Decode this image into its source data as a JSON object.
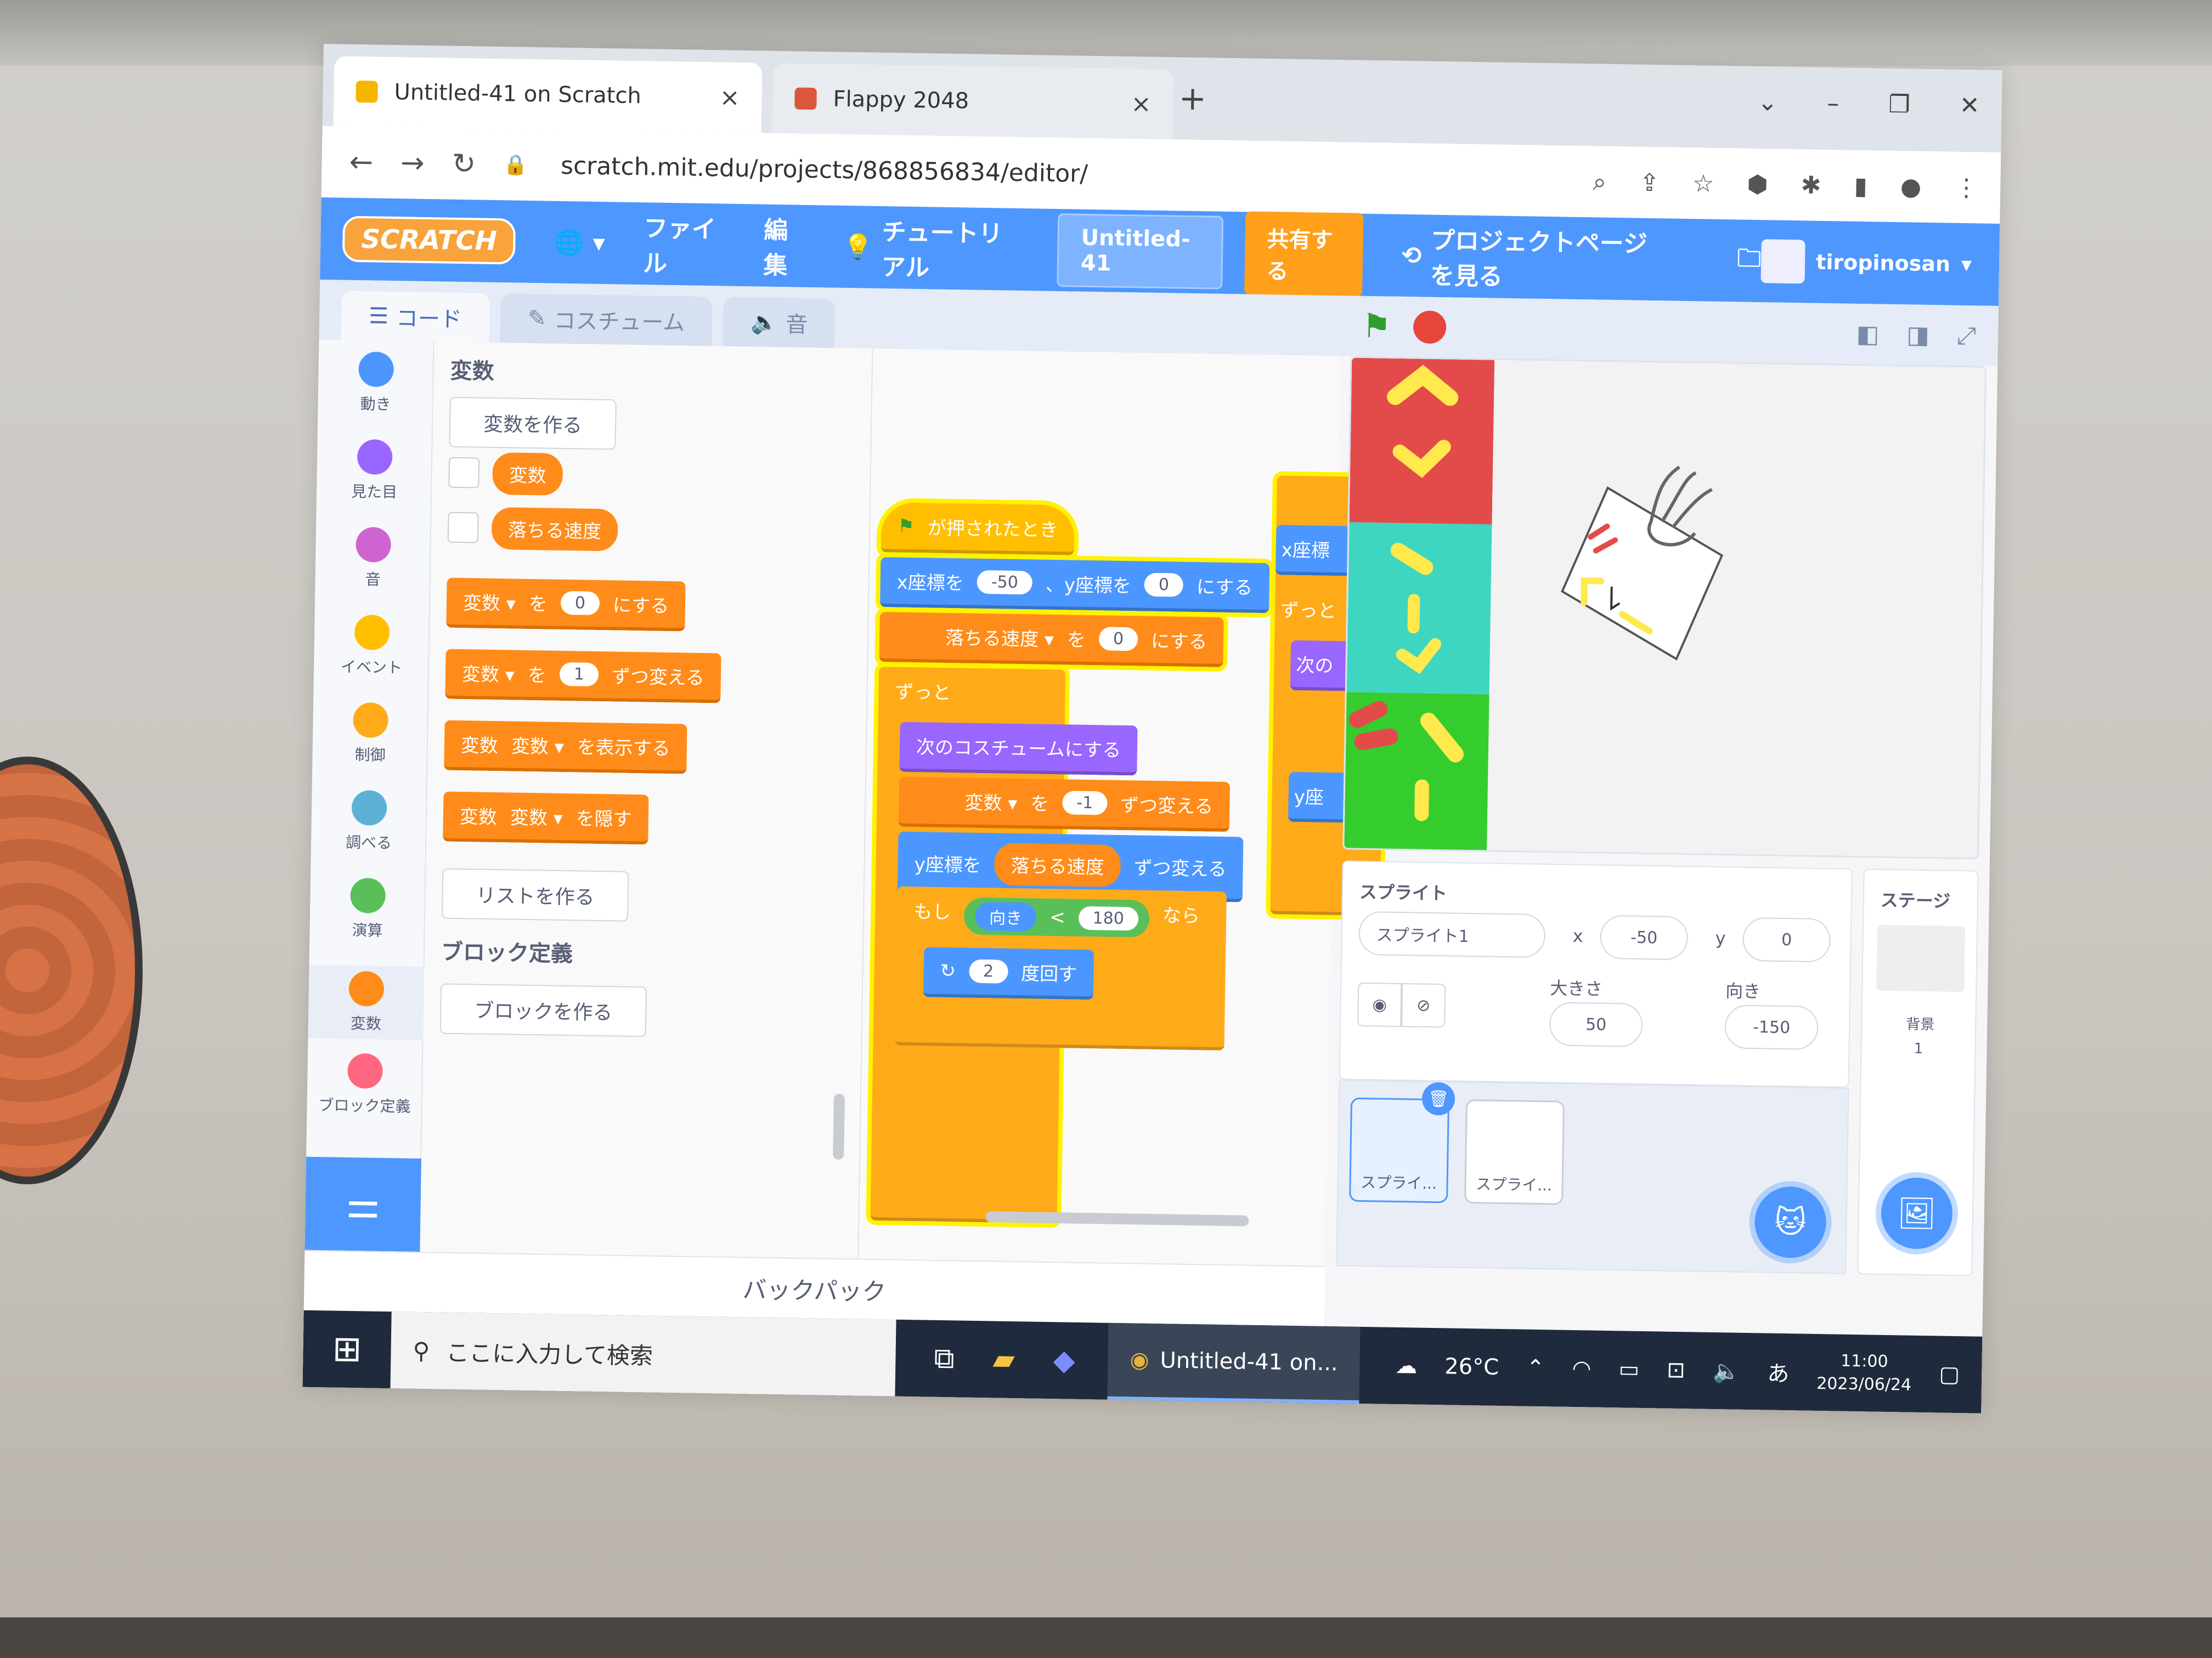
{
  "browser": {
    "tabs": [
      {
        "title": "Untitled-41 on Scratch",
        "close": "×"
      },
      {
        "title": "Flappy 2048",
        "close": "×"
      }
    ],
    "new_tab": "+",
    "url": "scratch.mit.edu/projects/868856834/editor/",
    "window_controls": [
      "⌄",
      "–",
      "❐",
      "✕"
    ]
  },
  "scratch_menu": {
    "logo": "SCRATCH",
    "language_icon": "🌐",
    "file": "ファイル",
    "edit": "編集",
    "tutorial": "チュートリアル",
    "project_title": "Untitled-41",
    "share": "共有する",
    "see_project_page": "プロジェクトページを見る",
    "username": "tiropinosan"
  },
  "editor_tabs": {
    "code": "コード",
    "costumes": "コスチューム",
    "sounds": "音"
  },
  "categories": [
    {
      "label": "動き",
      "color": "#4c97ff"
    },
    {
      "label": "見た目",
      "color": "#9966ff"
    },
    {
      "label": "音",
      "color": "#cf63cf"
    },
    {
      "label": "イベント",
      "color": "#ffbf00"
    },
    {
      "label": "制御",
      "color": "#ffab19"
    },
    {
      "label": "調べる",
      "color": "#5cb1d6"
    },
    {
      "label": "演算",
      "color": "#59c059"
    },
    {
      "label": "変数",
      "color": "#ff8c1a"
    },
    {
      "label": "ブロック定義",
      "color": "#ff6680"
    }
  ],
  "palette": {
    "heading": "変数",
    "make_variable": "変数を作る",
    "var1": "変数",
    "var2": "落ちる速度",
    "set_block": {
      "var": "変数 ▾",
      "wo": "を",
      "value": "0",
      "suffix": "にする"
    },
    "change_block": {
      "var": "変数 ▾",
      "wo": "を",
      "value": "1",
      "suffix": "ずつ変える"
    },
    "show_block": {
      "prefix": "変数",
      "var": "変数 ▾",
      "suffix": "を表示する"
    },
    "hide_block": {
      "prefix": "変数",
      "var": "変数 ▾",
      "suffix": "を隠す"
    },
    "make_list": "リストを作る",
    "my_blocks_heading": "ブロック定義",
    "make_block": "ブロックを作る"
  },
  "script": {
    "when_flag": "が押されたとき",
    "goto": {
      "x_label": "x座標を",
      "x": "-50",
      "y_label": "、y座標を",
      "y": "0",
      "suffix": "にする"
    },
    "set_speed": {
      "var": "落ちる速度 ▾",
      "wo": "を",
      "value": "0",
      "suffix": "にする"
    },
    "forever": "ずっと",
    "next_costume": "次のコスチュームにする",
    "change_var": {
      "var": "変数 ▾",
      "wo": "を",
      "value": "-1",
      "suffix": "ずつ変える"
    },
    "change_y": {
      "label": "y座標を",
      "reporter": "落ちる速度",
      "suffix": "ずつ変える"
    },
    "if": {
      "label": "もし",
      "left": "向き",
      "op": "<",
      "right": "180",
      "then": "なら"
    },
    "turn": {
      "value": "2",
      "suffix": "度回す"
    },
    "partial_x": "x座標",
    "partial_forever": "ずっと",
    "partial_next": "次の",
    "partial_y": "y座"
  },
  "backpack": "バックパック",
  "sprite_info": {
    "sprite_label": "スプライト",
    "sprite_name": "スプライト1",
    "x_label": "x",
    "x": "-50",
    "y_label": "y",
    "y": "0",
    "size_label": "大きさ",
    "size": "50",
    "direction_label": "向き",
    "direction": "-150"
  },
  "sprites": [
    {
      "name": "スプライ..."
    },
    {
      "name": "スプライ..."
    }
  ],
  "stage_pane": {
    "title": "ステージ",
    "backdrops_label": "背景",
    "backdrops_count": "1"
  },
  "taskbar": {
    "search_placeholder": "ここに入力して検索",
    "chrome_task": "Untitled-41 on...",
    "weather": "26°C",
    "ime": "あ",
    "time": "11:00",
    "date": "2023/06/24"
  }
}
